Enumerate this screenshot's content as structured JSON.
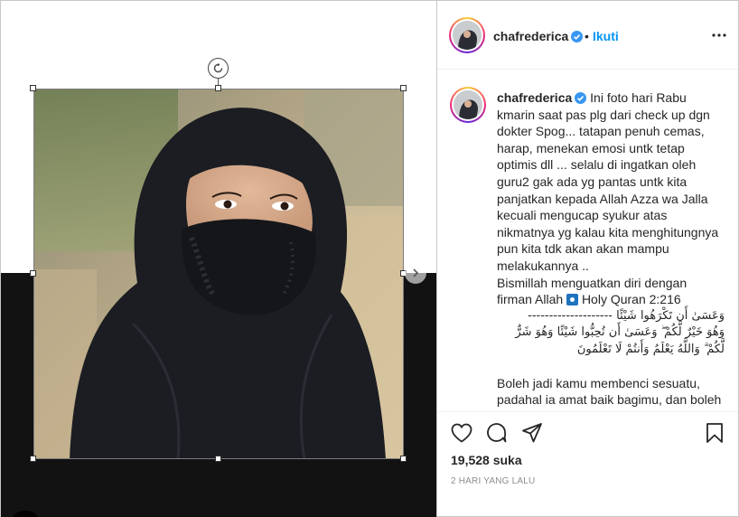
{
  "post": {
    "username": "chafrederica",
    "separator": "•",
    "follow_label": "Ikuti",
    "more_label": "more-options"
  },
  "caption": {
    "username": "chafrederica",
    "lines_1": "Ini foto hari Rabu kmarin saat pas plg dari check up dgn dokter Spog... tatapan penuh cemas, harap, menekan emosi untk tetap optimis dll ... selalu di ingatkan oleh guru2 gak ada yg pantas untk kita panjatkan kepada Allah Azza wa Jalla kecuali mengucap syukur atas nikmatnya yg kalau kita menghitungnya pun kita tdk akan akan mampu melakukannya ..",
    "lines_2_a": "Bismillah menguatkan diri dengan firman Allah",
    "lines_2_b": "Holy Quran 2:216",
    "dashes": "--------------------",
    "arabic_1": "وَعَسَىٰ أَن تَكْرَهُوا شَيْئًا",
    "arabic_2": "وَهُوَ خَيْرٌ لَّكُمْ ۖ وَعَسَىٰ أَن تُحِبُّوا شَيْئًا وَهُوَ شَرٌّ لَّكُمْ ۗ وَاللَّهُ يَعْلَمُ وَأَنتُمْ لَا تَعْلَمُونَ",
    "lines_3": "Boleh jadi kamu membenci sesuatu, padahal ia amat baik bagimu, dan boleh jadi (pula) kamu menyukai"
  },
  "stats": {
    "likes": "19,528 suka",
    "time": "2 HARI YANG LALU"
  },
  "colors": {
    "accent": "#0095f6",
    "verified": "#3897f0",
    "dark_panel": "#121212"
  },
  "icons": {
    "like": "heart-icon",
    "comment": "comment-icon",
    "share": "paper-plane-icon",
    "save": "bookmark-icon",
    "rotate": "rotate-icon",
    "next": "chevron-right-icon"
  }
}
